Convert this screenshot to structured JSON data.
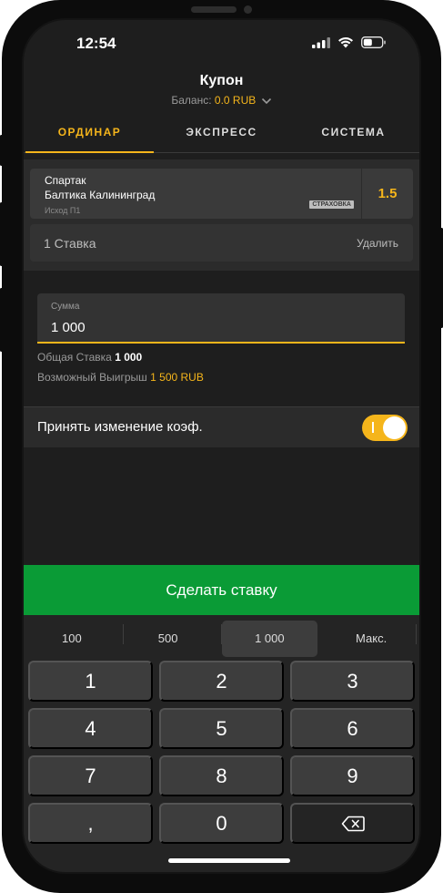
{
  "status": {
    "time": "12:54"
  },
  "header": {
    "title": "Купон",
    "balance_label": "Баланс:",
    "balance_value": "0.0 RUB"
  },
  "tabs": [
    {
      "label": "ОРДИНАР",
      "active": true
    },
    {
      "label": "ЭКСПРЕСС",
      "active": false
    },
    {
      "label": "СИСТЕМА",
      "active": false
    }
  ],
  "bet": {
    "team1": "Спартак",
    "team2": "Балтика Калининград",
    "outcome": "Исход П1",
    "insurance_badge": "СТРАХОВКА",
    "odds": "1.5"
  },
  "stakes": {
    "label": "1 Ставка",
    "delete_label": "Удалить"
  },
  "amount": {
    "label": "Сумма",
    "value": "1 000"
  },
  "summary": {
    "total_label": "Общая Ставка",
    "total_value": "1 000",
    "win_label": "Возможный Выигрыш",
    "win_value": "1 500 RUB"
  },
  "accept": {
    "label": "Принять изменение коэф.",
    "enabled": true
  },
  "place_bet_label": "Сделать ставку",
  "quick_amounts": [
    "100",
    "500",
    "1 000",
    "Макс."
  ],
  "keys": [
    "1",
    "2",
    "3",
    "4",
    "5",
    "6",
    "7",
    "8",
    "9",
    ",",
    "0"
  ],
  "colors": {
    "accent": "#f5b51b",
    "cta": "#0a9b36",
    "background": "#1e1e1e"
  }
}
